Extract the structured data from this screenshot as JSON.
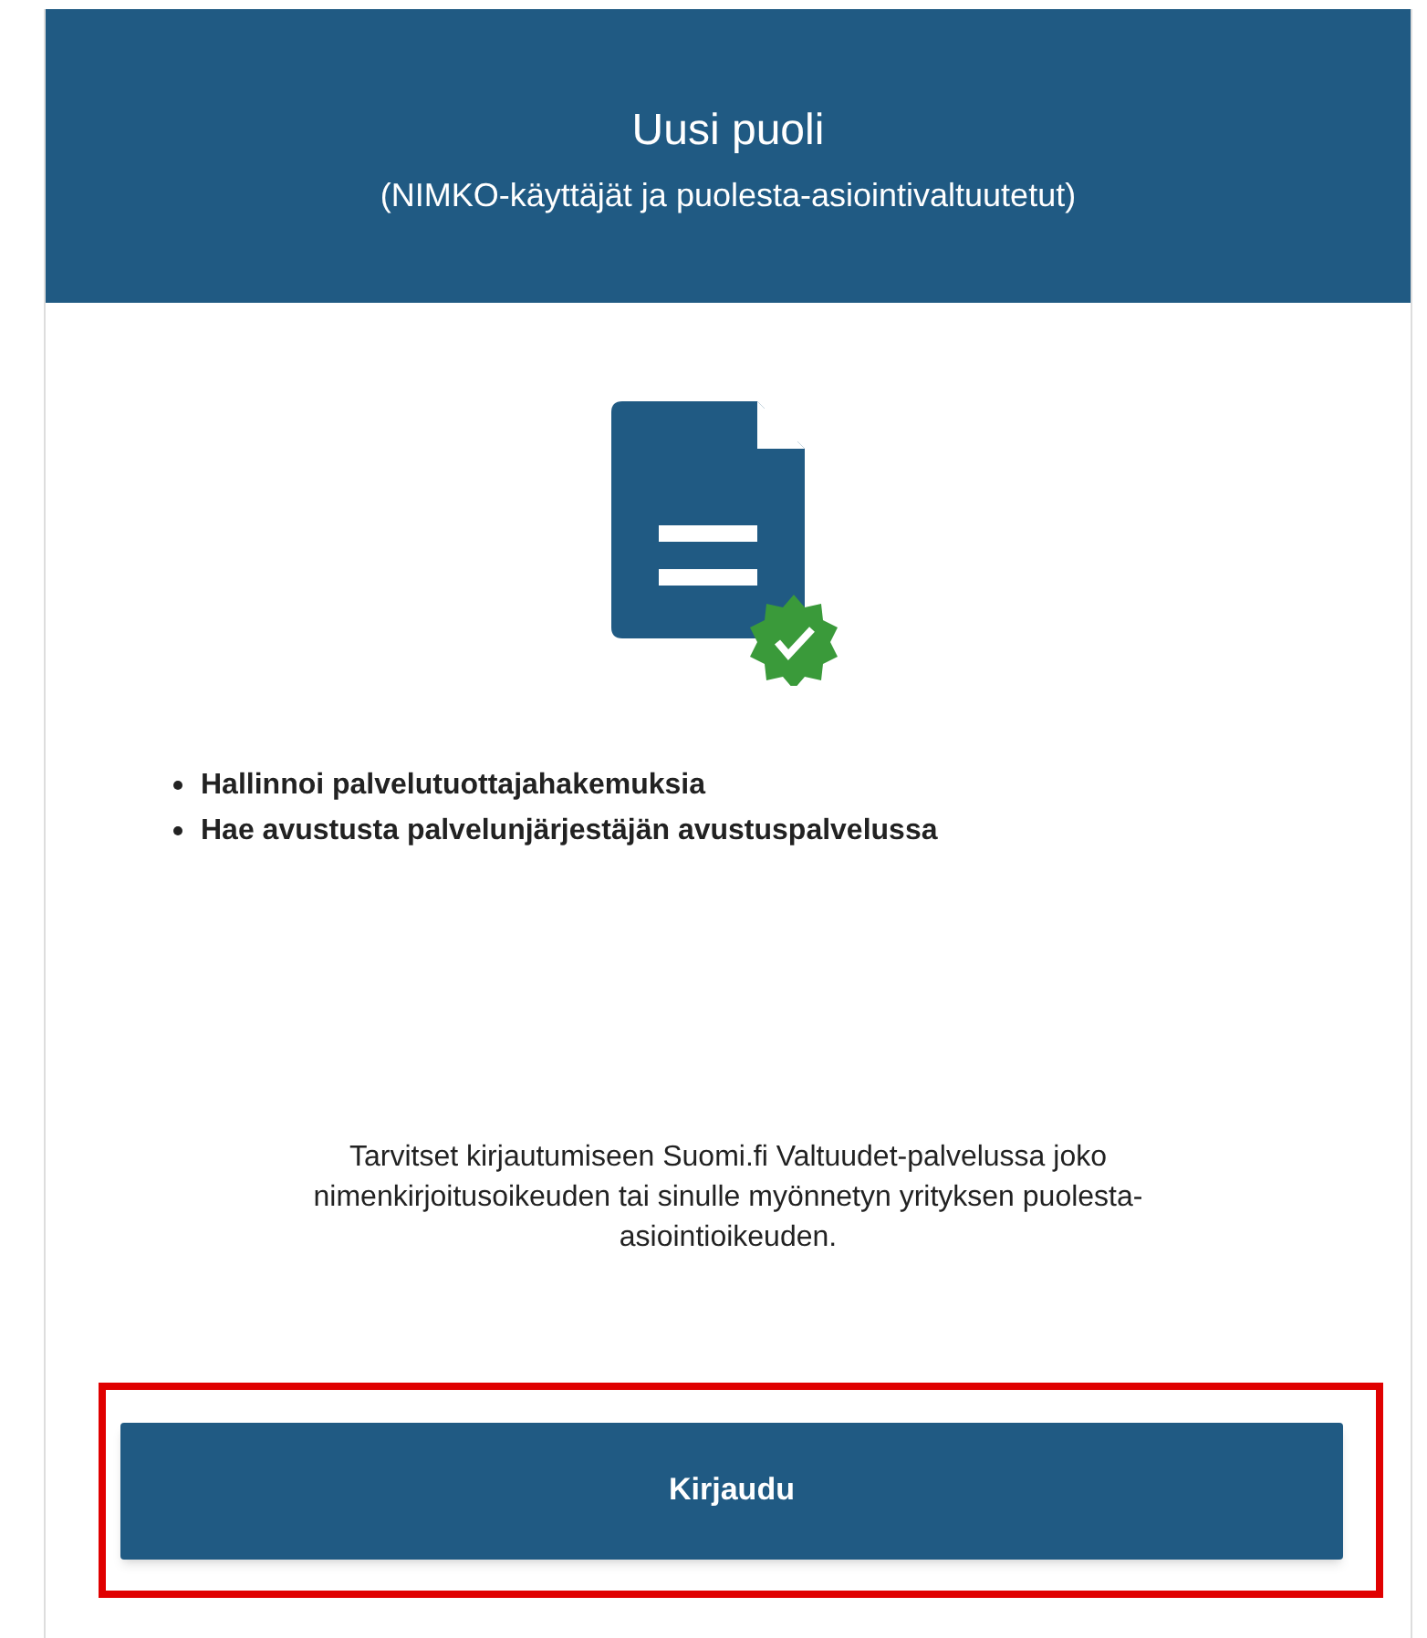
{
  "header": {
    "title": "Uusi puoli",
    "subtitle": "(NIMKO-käyttäjät ja puolesta-asiointivaltuutetut)"
  },
  "features": [
    "Hallinnoi palvelutuottajahakemuksia",
    "Hae avustusta palvelunjärjestäjän avustuspalvelussa"
  ],
  "info": "Tarvitset kirjautumiseen Suomi.fi Valtuudet-palvelussa joko nimenkirjoitusoikeuden tai sinulle myönnetyn yrityksen puolesta-asiointioikeuden.",
  "login_button": {
    "label": "Kirjaudu",
    "highlighted": true
  }
}
